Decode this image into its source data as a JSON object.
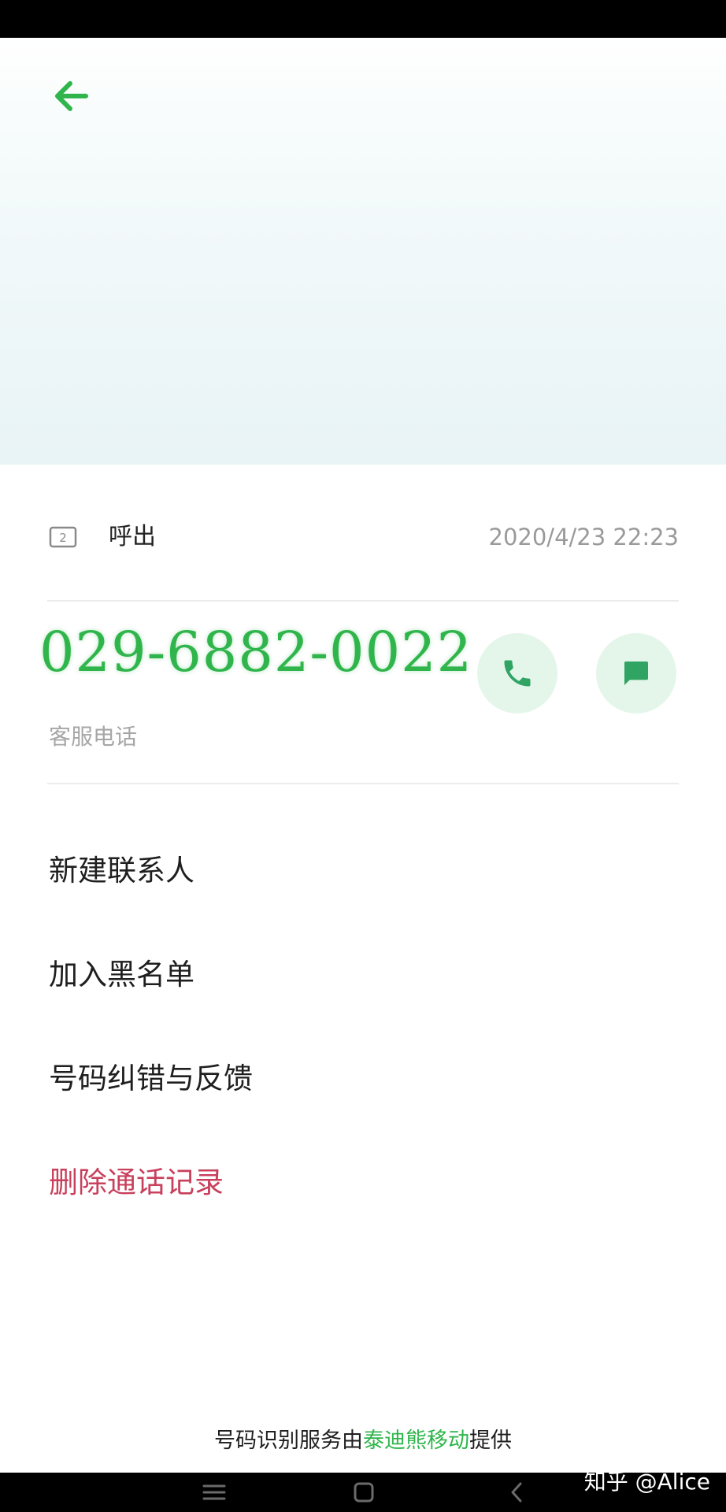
{
  "header": {
    "back_icon": "arrow-left-icon"
  },
  "call_info": {
    "sim_icon": "sim-2-icon",
    "sim_number": "2",
    "type": "呼出",
    "datetime": "2020/4/23 22:23"
  },
  "number": {
    "value": "029-6882-0022",
    "label": "客服电话"
  },
  "actions": {
    "call_icon": "phone-icon",
    "message_icon": "message-icon"
  },
  "menu": {
    "new_contact": "新建联系人",
    "blacklist": "加入黑名单",
    "feedback": "号码纠错与反馈",
    "delete_log": "删除通话记录"
  },
  "footer": {
    "prefix": "号码识别服务由",
    "provider": "泰迪熊移动",
    "suffix": "提供"
  },
  "navbar": {
    "menu_icon": "menu-icon",
    "home_icon": "home-square-icon",
    "back_icon": "back-chevron-icon"
  },
  "watermark": "知乎 @Alice",
  "colors": {
    "accent": "#2fb54b",
    "danger": "#c8405c",
    "button_bg": "#e4f6ea"
  }
}
